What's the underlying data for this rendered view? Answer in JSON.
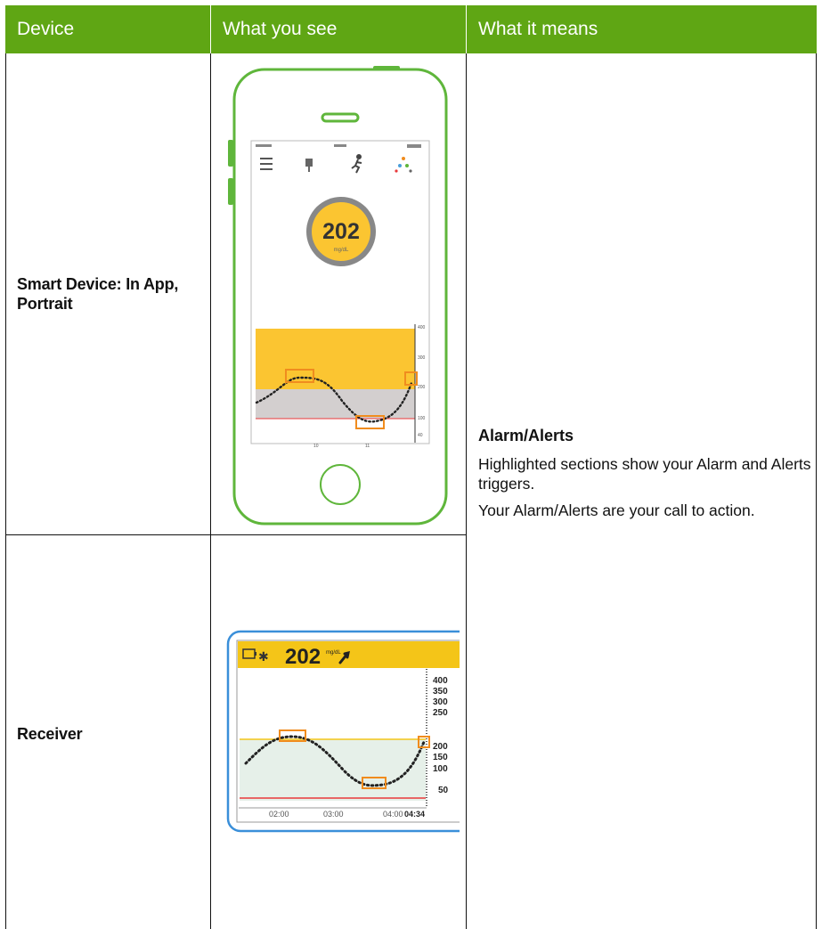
{
  "table": {
    "headers": [
      "Device",
      "What you see",
      "What it means"
    ],
    "rows": [
      {
        "device": "Smart Device: In App, Portrait",
        "phone": {
          "glucose_value": "202",
          "glucose_unit": "mg/dL",
          "graph_y_labels": [
            "400",
            "300",
            "200",
            "100",
            "40"
          ],
          "graph_x_labels": [
            "10",
            "11"
          ]
        }
      },
      {
        "device": "Receiver",
        "receiver": {
          "glucose_value": "202",
          "glucose_unit": "mg/dL",
          "y_labels": [
            "400",
            "350",
            "300",
            "250",
            "200",
            "150",
            "100",
            "50"
          ],
          "x_labels": [
            "02:00",
            "03:00",
            "04:00"
          ],
          "current_time": "04:34"
        }
      }
    ],
    "meaning": {
      "title": "Alarm/Alerts",
      "paragraphs": [
        "Highlighted sections show your Alarm and Alerts triggers.",
        "Your Alarm/Alerts are your call to action."
      ]
    }
  },
  "colors": {
    "header_bg": "#5fa614",
    "phone_outline": "#5fb63b",
    "alert_box": "#f08c1e",
    "high_band": "#fbc531",
    "target_band": "#d3cfcf",
    "low_line": "#e8393b",
    "receiver_outline": "#3a8fd9"
  }
}
